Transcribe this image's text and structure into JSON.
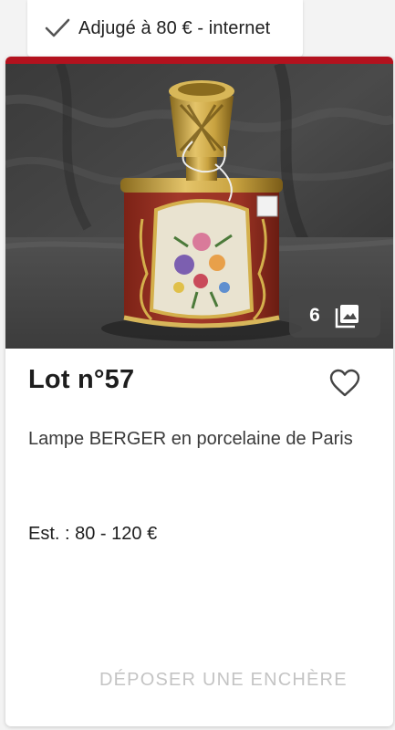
{
  "badge": {
    "icon": "check-icon",
    "text": "Adjugé à 80 € - internet"
  },
  "card": {
    "accent_color": "#b3121e",
    "photo": {
      "alt_icon": "photo-gallery-icon",
      "photo_count": "6"
    },
    "lot_title": "Lot n°57",
    "favorite_icon": "heart-outline-icon",
    "description": "Lampe BERGER en porcelaine de Paris",
    "estimate": "Est. : 80 - 120 €",
    "bid_button_label": "DÉPOSER UNE ENCHÈRE"
  }
}
